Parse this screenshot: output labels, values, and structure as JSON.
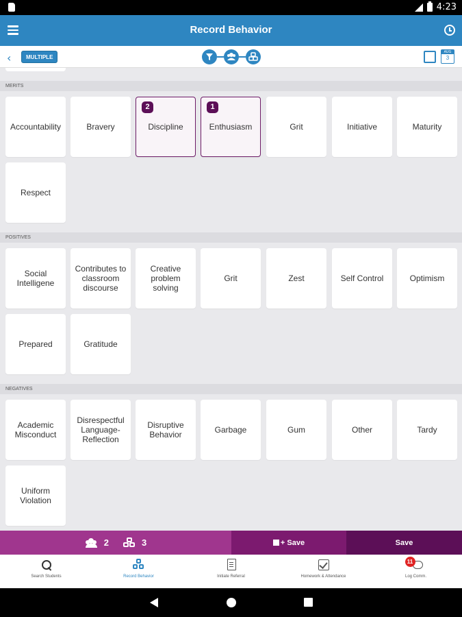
{
  "status_bar": {
    "time": "4:23"
  },
  "app_bar": {
    "title": "Record Behavior"
  },
  "toolbar": {
    "multiple_label": "MULTIPLE",
    "back_glyph": "‹",
    "calendar_month": "AUG",
    "calendar_day": "3",
    "steps": [
      "filter-icon",
      "students-icon",
      "behaviors-icon"
    ]
  },
  "sections": [
    {
      "title": "MERITS",
      "tiles": [
        {
          "label": "Accountability",
          "count": null
        },
        {
          "label": "Bravery",
          "count": null
        },
        {
          "label": "Discipline",
          "count": "2"
        },
        {
          "label": "Enthusiasm",
          "count": "1"
        },
        {
          "label": "Grit",
          "count": null
        },
        {
          "label": "Initiative",
          "count": null
        },
        {
          "label": "Maturity",
          "count": null
        },
        {
          "label": "Respect",
          "count": null
        }
      ]
    },
    {
      "title": "POSITIVES",
      "tiles": [
        {
          "label": "Social Intelligene",
          "count": null
        },
        {
          "label": "Contributes to classroom discourse",
          "count": null
        },
        {
          "label": "Creative problem solving",
          "count": null
        },
        {
          "label": "Grit",
          "count": null
        },
        {
          "label": "Zest",
          "count": null
        },
        {
          "label": "Self Control",
          "count": null
        },
        {
          "label": "Optimism",
          "count": null
        },
        {
          "label": "Prepared",
          "count": null
        },
        {
          "label": "Gratitude",
          "count": null
        }
      ]
    },
    {
      "title": "NEGATIVES",
      "tiles": [
        {
          "label": "Academic Misconduct",
          "count": null
        },
        {
          "label": "Disrespectful Language-Reflection",
          "count": null
        },
        {
          "label": "Disruptive Behavior",
          "count": null
        },
        {
          "label": "Garbage",
          "count": null
        },
        {
          "label": "Gum",
          "count": null
        },
        {
          "label": "Other",
          "count": null
        },
        {
          "label": "Tardy",
          "count": null
        },
        {
          "label": "Uniform Violation",
          "count": null
        }
      ]
    }
  ],
  "bottom_bar": {
    "student_count": "2",
    "behavior_count": "3",
    "save_add_label": "+ Save",
    "save_label": "Save"
  },
  "tabs": [
    {
      "label": "Search Students",
      "icon": "search-icon",
      "active": false,
      "badge": null
    },
    {
      "label": "Record Behavior",
      "icon": "cubes-icon",
      "active": true,
      "badge": null
    },
    {
      "label": "Initiate Referral",
      "icon": "document-icon",
      "active": false,
      "badge": null
    },
    {
      "label": "Homework & Attendance",
      "icon": "checkbox-icon",
      "active": false,
      "badge": null
    },
    {
      "label": "Log Comm.",
      "icon": "chat-icon",
      "active": false,
      "badge": "11"
    }
  ],
  "colors": {
    "primary_blue": "#2e86c1",
    "purple_dark": "#5c0f57",
    "purple_mid": "#7c1a6f",
    "purple_light": "#a0368e",
    "notification_red": "#e02424"
  }
}
